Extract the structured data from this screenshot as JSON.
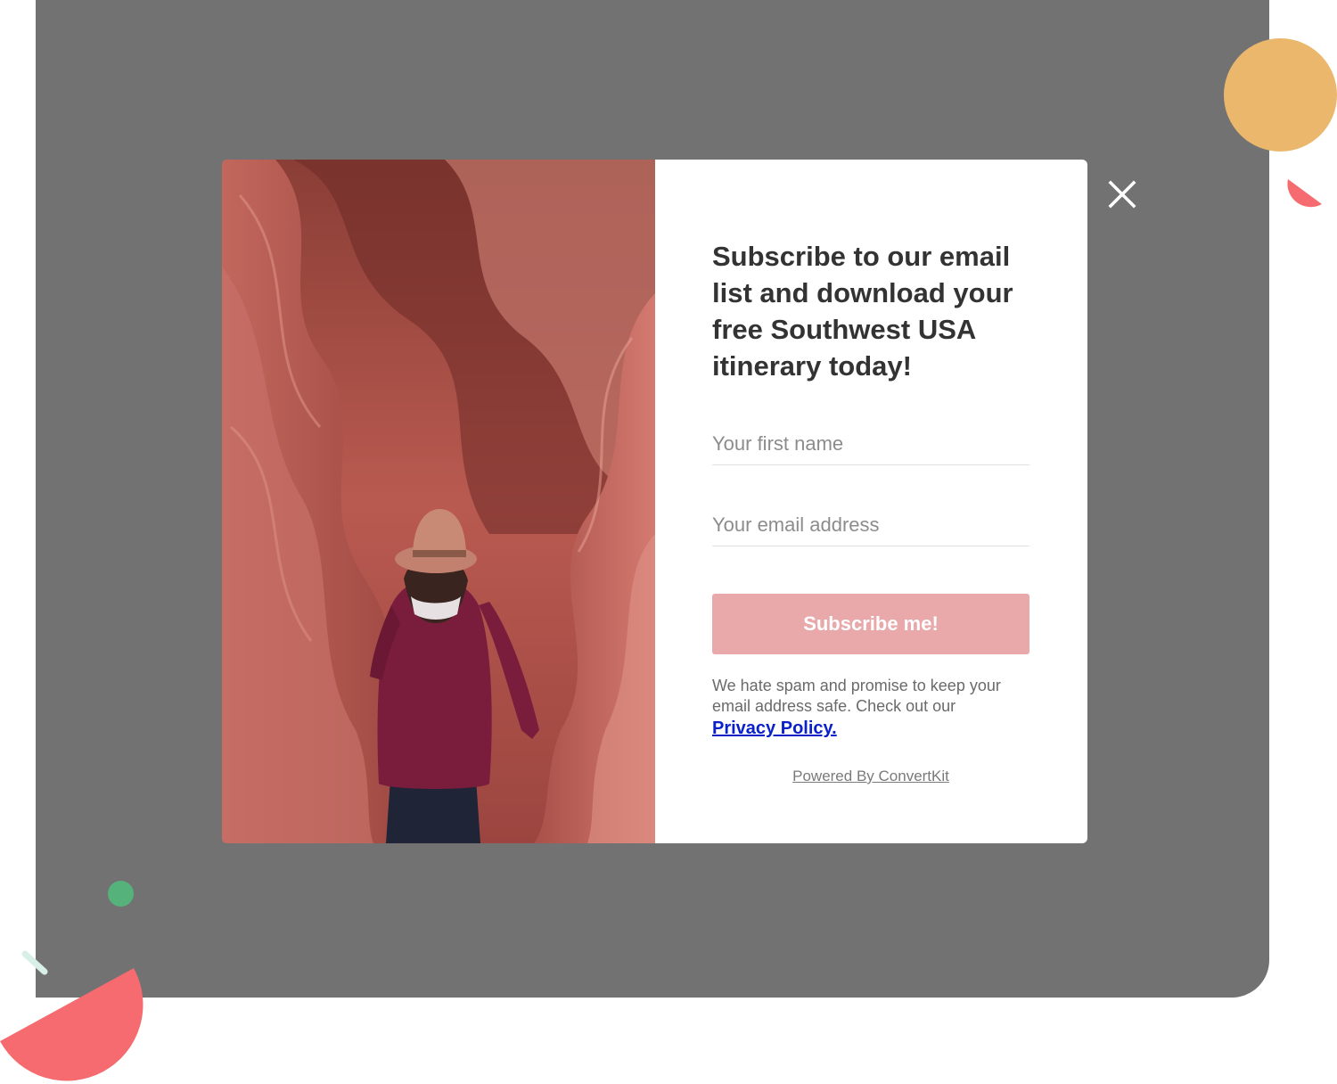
{
  "modal": {
    "headline": "Subscribe to our email list and download your free Southwest USA itinerary today!",
    "first_name_placeholder": "Your first name",
    "email_placeholder": "Your email address",
    "subscribe_label": "Subscribe me!",
    "spam_note": "We hate spam and promise to keep your email address safe. Check out our",
    "privacy_link": "Privacy Policy.",
    "powered_by": "Powered By ConvertKit"
  },
  "icons": {
    "close": "close-icon",
    "hero": "canyon-hiker-photo"
  },
  "colors": {
    "overlay": "#727272",
    "button": "#e9a9ab",
    "link": "#0a20c8",
    "accent_orange": "#ebb76d",
    "accent_pink": "#f56b6f",
    "accent_green": "#55b27a"
  }
}
